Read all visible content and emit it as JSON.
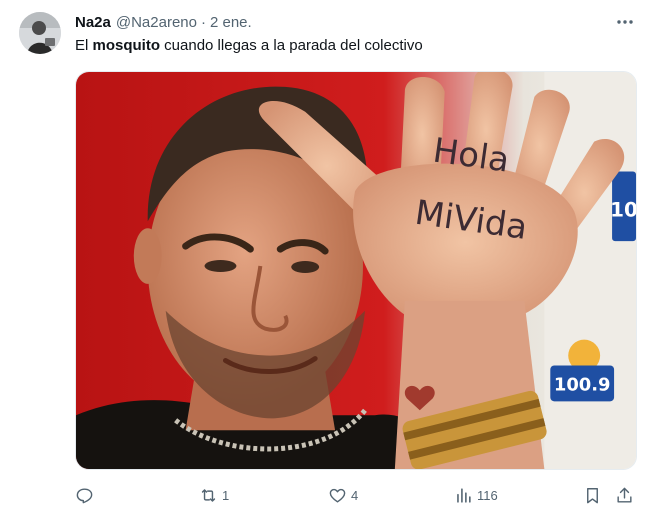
{
  "tweet": {
    "author_name": "Na2a",
    "author_handle": "@Na2areno",
    "separator": "·",
    "date": "2 ene.",
    "text_before": "El ",
    "text_bold": "mosquito",
    "text_after": " cuando llegas a la parada del colectivo"
  },
  "media": {
    "hand_text_line1": "Hola",
    "hand_text_line2": "MiVida",
    "logo_text": "100.9",
    "logo_text_top": "10"
  },
  "actions": {
    "reply_count": "",
    "retweet_count": "1",
    "like_count": "4",
    "views_count": "116"
  },
  "icons": {
    "reply": "reply-icon",
    "retweet": "retweet-icon",
    "like": "heart-icon",
    "views": "analytics-icon",
    "bookmark": "bookmark-icon",
    "share": "share-icon",
    "more": "more-icon"
  },
  "colors": {
    "text": "#0f1419",
    "secondary": "#536471",
    "media_background": "#c91818"
  }
}
